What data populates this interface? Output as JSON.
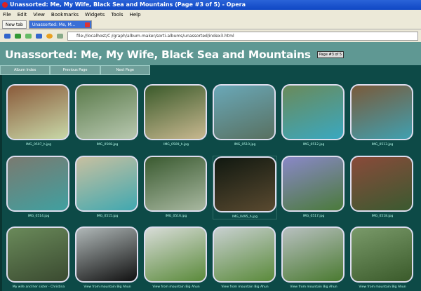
{
  "window": {
    "title": "Unassorted: Me, My Wife, Black Sea and Mountains (Page #3 of 5) - Opera"
  },
  "menu": [
    "File",
    "Edit",
    "View",
    "Bookmarks",
    "Widgets",
    "Tools",
    "Help"
  ],
  "tabs": [
    {
      "label": "New tab"
    },
    {
      "label": "Unassorted: Me, M..."
    }
  ],
  "address": "file://localhost/C:/graph/album-maker/sorti-albums/unassorted/index3.html",
  "page": {
    "title": "Unassorted: Me, My Wife, Black Sea and Mountains",
    "header_button": "Page #3 of 5"
  },
  "nav": [
    "Album Index",
    "Previous Page",
    "Next Page"
  ],
  "gallery": [
    {
      "caption": "IMG_0507_h.jpg",
      "colors": [
        "#8a5a3a",
        "#c8d8a8"
      ]
    },
    {
      "caption": "IMG_0508.jpg",
      "colors": [
        "#5a7a4a",
        "#b8c8b0"
      ]
    },
    {
      "caption": "IMG_0509_h.jpg",
      "colors": [
        "#3a5a2a",
        "#c8b890"
      ]
    },
    {
      "caption": "IMG_0510.jpg",
      "colors": [
        "#6aa8b8",
        "#587060"
      ]
    },
    {
      "caption": "IMG_0512.jpg",
      "colors": [
        "#6a8a5a",
        "#3aa8c0"
      ]
    },
    {
      "caption": "IMG_0513.jpg",
      "colors": [
        "#7a5a3a",
        "#40a0b0"
      ]
    },
    {
      "caption": "IMG_0514.jpg",
      "colors": [
        "#7a7a70",
        "#40a0a0"
      ]
    },
    {
      "caption": "IMG_0515.jpg",
      "colors": [
        "#c8c0a0",
        "#40a8b0"
      ]
    },
    {
      "caption": "IMG_0516.jpg",
      "colors": [
        "#3a5a30",
        "#a8b8a0"
      ]
    },
    {
      "caption": "IMG_0495_h.jpg",
      "colors": [
        "#101810",
        "#5a4a30"
      ]
    },
    {
      "caption": "IMG_0517.jpg",
      "colors": [
        "#8a88c8",
        "#4a7a3a"
      ]
    },
    {
      "caption": "IMG_0518.jpg",
      "colors": [
        "#8a4a3a",
        "#3a5a30"
      ]
    },
    {
      "caption": "My wife and her sister - Christina",
      "colors": [
        "#6a8a5a",
        "#3a4a30"
      ]
    },
    {
      "caption": "View from mountain Big Ahun",
      "colors": [
        "#b0b8b8",
        "#101010"
      ]
    },
    {
      "caption": "View from mountain Big Ahun",
      "colors": [
        "#d8dcd8",
        "#5a8a3a"
      ]
    },
    {
      "caption": "View from mountain Big Ahun",
      "colors": [
        "#c8d0d0",
        "#5a8a3a"
      ]
    },
    {
      "caption": "View from mountain Big Ahun",
      "colors": [
        "#b8c0c0",
        "#4a7a30"
      ]
    },
    {
      "caption": "View from mountain Big Ahun",
      "colors": [
        "#7a9a6a",
        "#3a5a2a"
      ]
    }
  ]
}
